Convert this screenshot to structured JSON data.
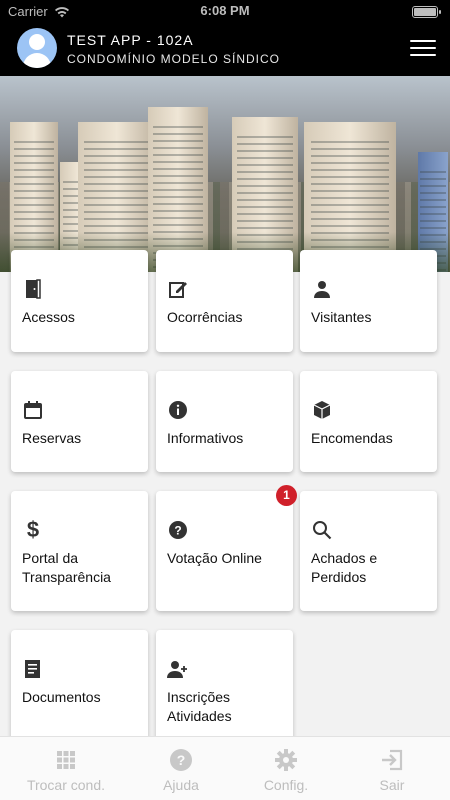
{
  "status_bar": {
    "carrier": "Carrier",
    "time": "6:08 PM"
  },
  "header": {
    "title": "TEST APP - 102A",
    "subtitle": "CONDOMÍNIO MODELO SÍNDICO"
  },
  "tiles": [
    {
      "label": "Acessos",
      "icon": "door-icon"
    },
    {
      "label": "Ocorrências",
      "icon": "edit-icon"
    },
    {
      "label": "Visitantes",
      "icon": "person-icon"
    },
    {
      "label": "Reservas",
      "icon": "calendar-icon"
    },
    {
      "label": "Informativos",
      "icon": "info-icon"
    },
    {
      "label": "Encomendas",
      "icon": "package-icon"
    },
    {
      "label": "Portal da Transparência",
      "icon": "dollar-icon"
    },
    {
      "label": "Votação Online",
      "icon": "question-icon",
      "badge": "1"
    },
    {
      "label": "Achados e Perdidos",
      "icon": "search-icon"
    },
    {
      "label": "Documentos",
      "icon": "document-icon"
    },
    {
      "label": "Inscrições Atividades",
      "icon": "add-person-icon"
    }
  ],
  "tabbar": [
    {
      "label": "Trocar cond.",
      "icon": "grid-icon"
    },
    {
      "label": "Ajuda",
      "icon": "help-icon"
    },
    {
      "label": "Config.",
      "icon": "gear-icon"
    },
    {
      "label": "Sair",
      "icon": "logout-icon"
    }
  ],
  "colors": {
    "header_bg": "#000000",
    "badge": "#d0202a",
    "tab_inactive": "#bdbdbd"
  }
}
